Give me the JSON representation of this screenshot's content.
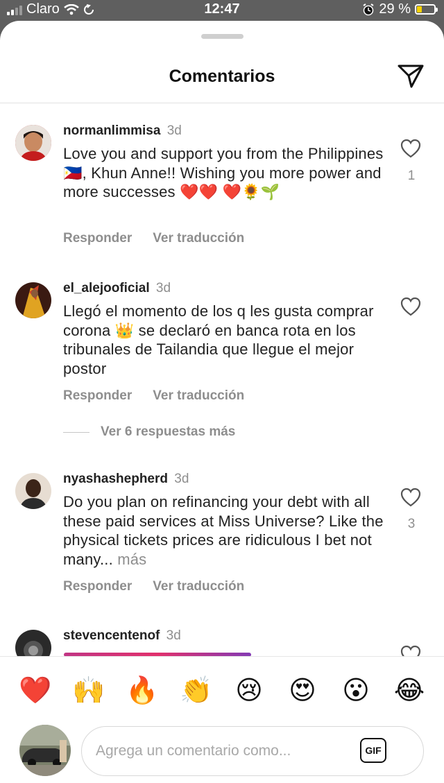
{
  "status_bar": {
    "carrier": "Claro",
    "time": "12:47",
    "battery": "29 %"
  },
  "header": {
    "title": "Comentarios",
    "send_icon": "paper-plane-icon"
  },
  "comments": [
    {
      "username": "normanlimmisa",
      "time": "3d",
      "text": "Love you and support you from the Philippines 🇵🇭, Khun Anne!! Wishing you more power and more successes ❤️❤️ ❤️🌻🌱",
      "like_count": "1",
      "reply_label": "Responder",
      "translate_label": "Ver traducción"
    },
    {
      "username": "el_alejooficial",
      "time": "3d",
      "text": "Llegó el momento de los q les gusta comprar corona 👑 se declaró en banca rota en los tribunales de Tailandia que llegue el mejor postor",
      "reply_label": "Responder",
      "translate_label": "Ver traducción",
      "more_replies": "Ver 6 respuestas más"
    },
    {
      "username": "nyashashepherd",
      "time": "3d",
      "text": "Do you plan on refinancing your debt with all these paid services at Miss Universe? Like the physical tickets prices are ridiculous I bet not many...",
      "more": "más",
      "like_count": "3",
      "reply_label": "Responder",
      "translate_label": "Ver traducción"
    },
    {
      "username": "stevencentenof",
      "time": "3d"
    }
  ],
  "reactions": [
    "❤️",
    "🙌",
    "🔥",
    "👏",
    "😢",
    "😍",
    "😮",
    "😂"
  ],
  "composer": {
    "placeholder": "Agrega un comentario como...",
    "gif_label": "GIF"
  }
}
